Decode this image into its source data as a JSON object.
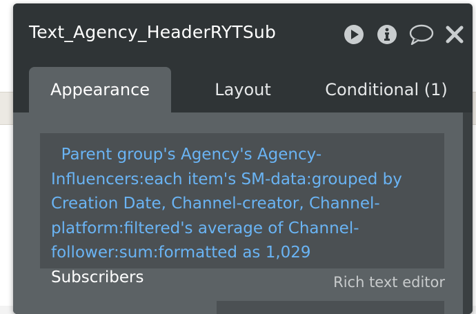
{
  "panel": {
    "title": "Text_Agency_HeaderRYTSub",
    "icons": {
      "preview": "play-circle-icon",
      "info": "info-circle-icon",
      "comments": "speech-bubble-icon",
      "close": "close-x-icon"
    }
  },
  "tabs": [
    {
      "label": "Appearance",
      "active": true
    },
    {
      "label": "Layout",
      "active": false
    },
    {
      "label": "Conditional (1)",
      "active": false
    }
  ],
  "text_field": {
    "dynamic_expression": "  Parent group's Agency's Agency-Influencers:each item's SM-data:grouped by Creation Date, Channel-creator, Channel-platform:filtered's average of Channel-follower:sum:formatted as 1,029",
    "static_text": "Subscribers"
  },
  "rich_text_editor_link": "Rich text editor",
  "colors": {
    "panel_bg": "#2f3436",
    "tab_active_bg": "#5c6265",
    "field_bg": "#4b5053",
    "dynamic_text": "#6ab4f4"
  }
}
